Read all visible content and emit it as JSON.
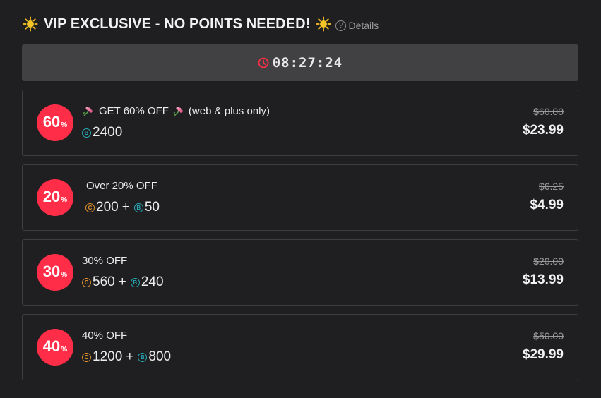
{
  "header": {
    "title": "VIP EXCLUSIVE - NO POINTS NEEDED!",
    "details_label": "Details",
    "left_icon": "sun-icon",
    "right_icon": "sun-icon"
  },
  "timer": {
    "value": "08:27:24",
    "icon": "clock-icon"
  },
  "colors": {
    "badge": "#ff2d48",
    "coin_c": "#e0902a",
    "coin_b": "#27a9b5",
    "timer_bg": "#414143",
    "clock": "#ff2d48"
  },
  "offers": [
    {
      "badge_num": "60",
      "badge_pct": "%",
      "title": "GET 60% OFF",
      "title_suffix": "(web & plus only)",
      "title_icons": "flower-icon",
      "costs": [
        {
          "coin": "b",
          "glyph": "B",
          "amount": "2400"
        }
      ],
      "old_price": "$60.00",
      "new_price": "$23.99"
    },
    {
      "badge_num": "20",
      "badge_pct": "%",
      "title": "Over 20% OFF",
      "costs": [
        {
          "coin": "c",
          "glyph": "C",
          "amount": "200"
        },
        {
          "coin": "b",
          "glyph": "B",
          "amount": "50"
        }
      ],
      "old_price": "$6.25",
      "new_price": "$4.99"
    },
    {
      "badge_num": "30",
      "badge_pct": "%",
      "title": "30% OFF",
      "costs": [
        {
          "coin": "c",
          "glyph": "C",
          "amount": "560"
        },
        {
          "coin": "b",
          "glyph": "B",
          "amount": "240"
        }
      ],
      "old_price": "$20.00",
      "new_price": "$13.99"
    },
    {
      "badge_num": "40",
      "badge_pct": "%",
      "title": "40% OFF",
      "costs": [
        {
          "coin": "c",
          "glyph": "C",
          "amount": "1200"
        },
        {
          "coin": "b",
          "glyph": "B",
          "amount": "800"
        }
      ],
      "old_price": "$50.00",
      "new_price": "$29.99"
    }
  ],
  "plus_sign": "+"
}
